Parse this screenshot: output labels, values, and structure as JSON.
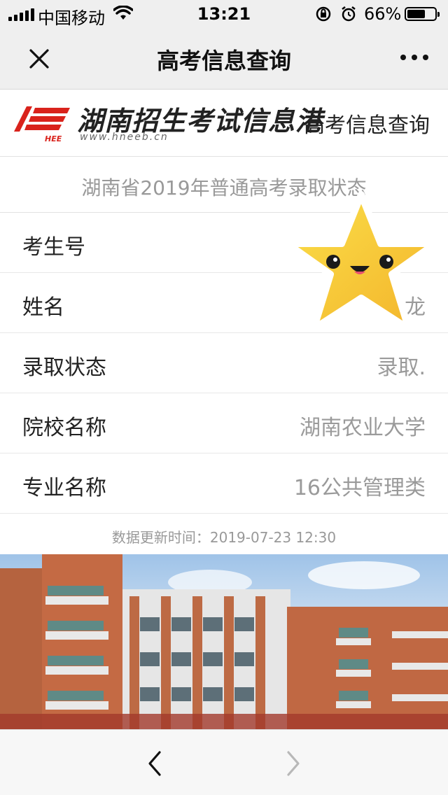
{
  "status_bar": {
    "carrier": "中国移动",
    "time": "13:21",
    "battery_percent": "66%",
    "battery_level": 0.66,
    "icons": [
      "signal-icon",
      "wifi-icon",
      "rotation-lock-icon",
      "alarm-icon",
      "battery-icon"
    ]
  },
  "nav": {
    "title": "高考信息查询",
    "close_icon": "close-icon",
    "more_icon": "more-icon"
  },
  "header": {
    "site_name": "湖南招生考试信息港",
    "site_url": "www.hneeb.cn",
    "logo_text": "HEE",
    "subtitle": "高考信息查询"
  },
  "result": {
    "title": "湖南省2019年普通高考录取状态",
    "rows": [
      {
        "label": "考生号",
        "value": ""
      },
      {
        "label": "姓名",
        "value": "龙"
      },
      {
        "label": "录取状态",
        "value": "录取."
      },
      {
        "label": "院校名称",
        "value": "湖南农业大学"
      },
      {
        "label": "专业名称",
        "value": "16公共管理类"
      }
    ],
    "update_time": "数据更新时间：2019-07-23 12:30"
  },
  "image": {
    "description_icon": "campus-building-photo"
  },
  "toolbar": {
    "back_icon": "back-arrow-icon",
    "forward_icon": "forward-arrow-icon"
  },
  "colors": {
    "bar_bg": "#efefef",
    "label_text": "#222222",
    "value_text": "#9a9a9a",
    "logo_red": "#d9231c",
    "star_yellow": "#f7c52b"
  }
}
